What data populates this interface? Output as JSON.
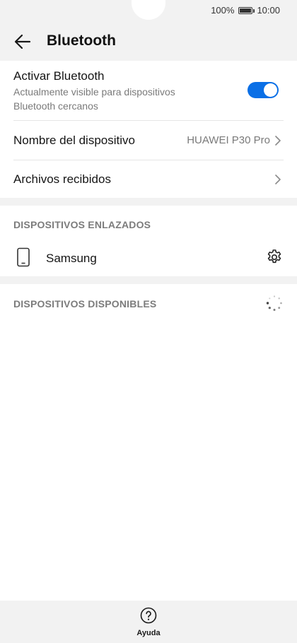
{
  "status": {
    "battery": "100%",
    "time": "10:00"
  },
  "header": {
    "title": "Bluetooth"
  },
  "bluetooth": {
    "title": "Activar Bluetooth",
    "subtitle_line1": "Actualmente visible para dispositivos",
    "subtitle_line2": "Bluetooth cercanos",
    "enabled": true
  },
  "device_name": {
    "label": "Nombre del dispositivo",
    "value": "HUAWEI P30 Pro"
  },
  "received_files": {
    "label": "Archivos recibidos"
  },
  "paired": {
    "header": "DISPOSITIVOS ENLAZADOS",
    "devices": [
      {
        "name": "Samsung"
      }
    ]
  },
  "available": {
    "header": "DISPOSITIVOS DISPONIBLES"
  },
  "footer": {
    "help_label": "Ayuda"
  },
  "colors": {
    "accent": "#0a6fe6",
    "header_bg": "#f2f2f2"
  }
}
